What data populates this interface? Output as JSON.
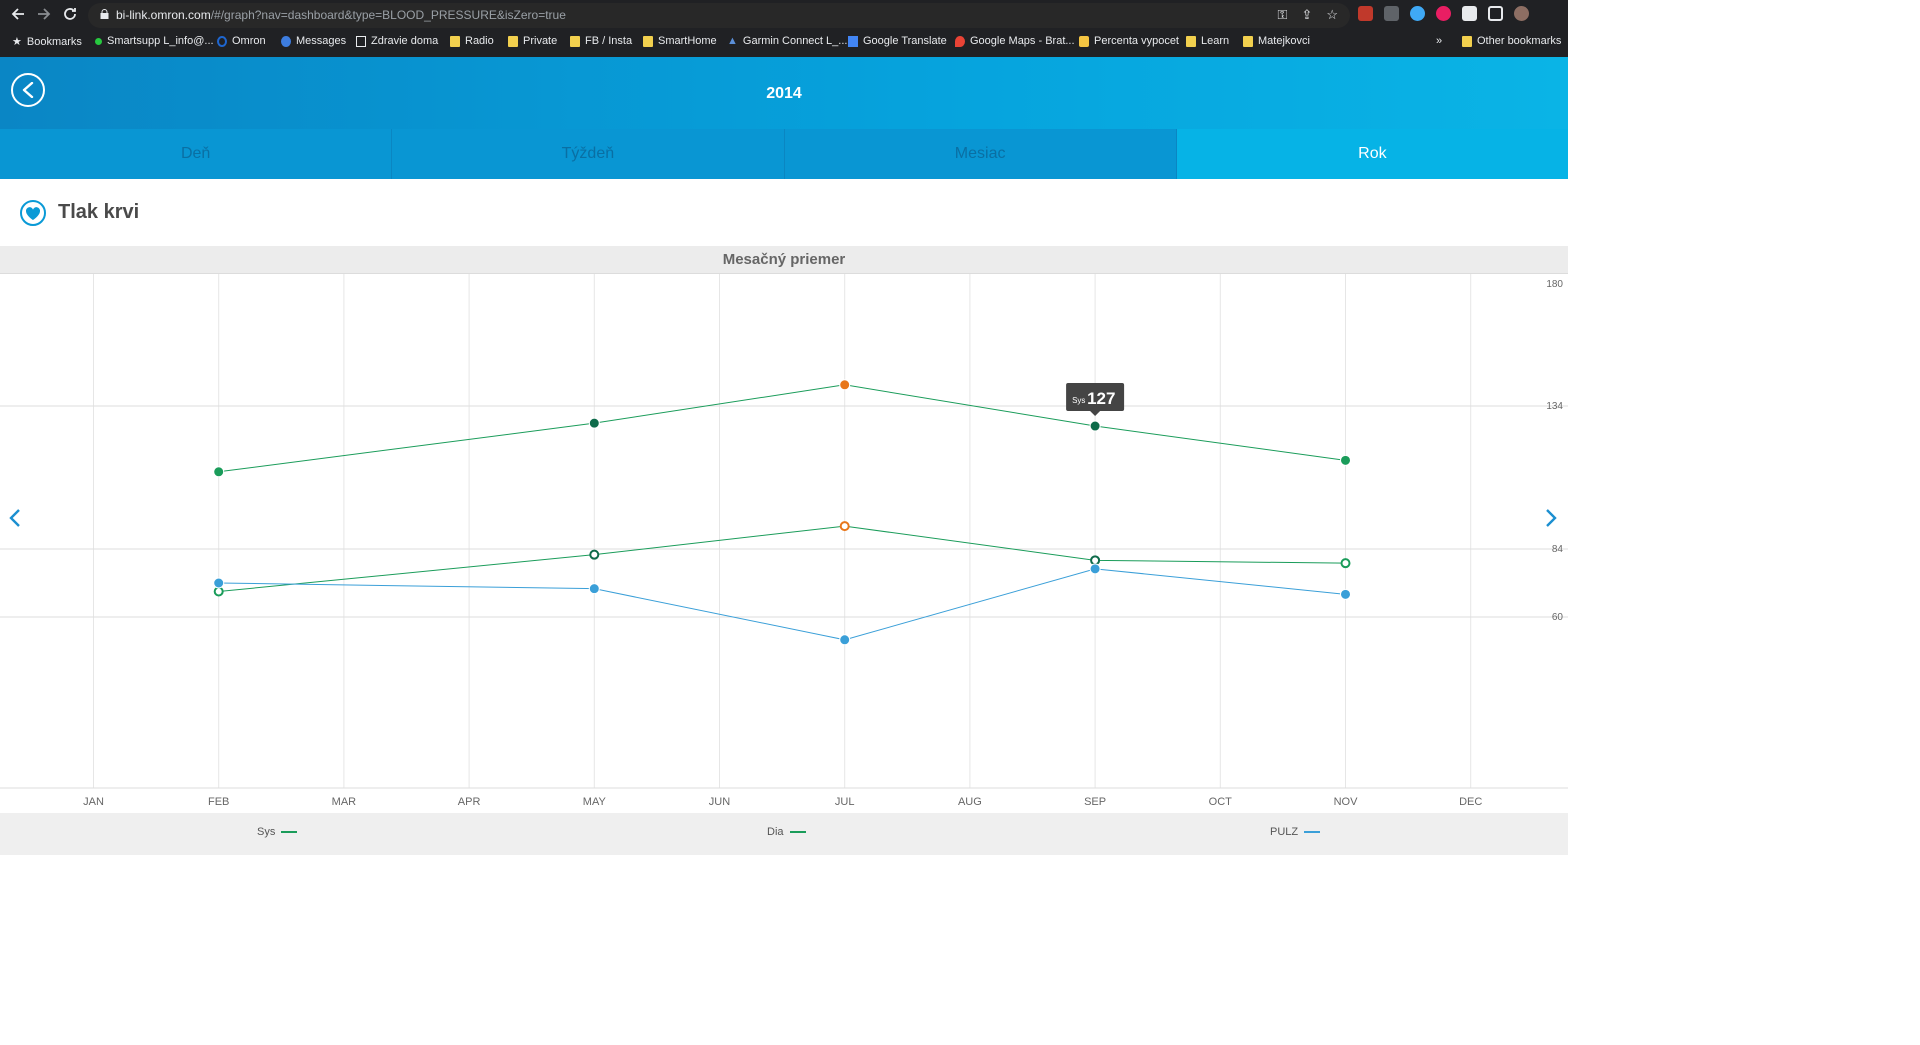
{
  "browser": {
    "url_domain": "bi-link.omron.com",
    "url_path": "/#/graph?nav=dashboard&type=BLOOD_PRESSURE&isZero=true",
    "bookmarks": [
      {
        "label": "Bookmarks",
        "icon": "star-icon"
      },
      {
        "label": "Smartsupp L_info@...",
        "icon": "dot-icon"
      },
      {
        "label": "Omron",
        "icon": "ring-icon"
      },
      {
        "label": "Messages",
        "icon": "chat-icon"
      },
      {
        "label": "Zdravie doma",
        "icon": "site-icon"
      },
      {
        "label": "Radio",
        "icon": "folder-icon"
      },
      {
        "label": "Private",
        "icon": "folder-icon"
      },
      {
        "label": "FB / Insta",
        "icon": "folder-icon"
      },
      {
        "label": "SmartHome",
        "icon": "folder-icon"
      },
      {
        "label": "Garmin Connect L_...",
        "icon": "garmin-icon"
      },
      {
        "label": "Google Translate",
        "icon": "translate-icon"
      },
      {
        "label": "Google Maps - Brat...",
        "icon": "maps-icon"
      },
      {
        "label": "Percenta vypocet",
        "icon": "site-icon"
      },
      {
        "label": "Learn",
        "icon": "folder-icon"
      },
      {
        "label": "Matejkovci",
        "icon": "folder-icon"
      }
    ],
    "overflow_label": "»",
    "other_bookmarks": "Other bookmarks"
  },
  "header": {
    "year": "2014",
    "tabs": [
      {
        "label": "Deň",
        "active": false
      },
      {
        "label": "Týždeň",
        "active": false
      },
      {
        "label": "Mesiac",
        "active": false
      },
      {
        "label": "Rok",
        "active": true
      }
    ]
  },
  "page": {
    "title": "Tlak krvi",
    "subtitle": "Mesačný priemer"
  },
  "chart_data": {
    "type": "line",
    "categories": [
      "JAN",
      "FEB",
      "MAR",
      "APR",
      "MAY",
      "JUN",
      "JUL",
      "AUG",
      "SEP",
      "OCT",
      "NOV",
      "DEC"
    ],
    "y_ticks": [
      180,
      134,
      84,
      60
    ],
    "ylim": [
      0,
      180
    ],
    "series": [
      {
        "name": "Sys",
        "color": "#1a9c5a",
        "points": [
          {
            "x": "FEB",
            "y": 111
          },
          {
            "x": "MAY",
            "y": 128
          },
          {
            "x": "JUL",
            "y": 142
          },
          {
            "x": "SEP",
            "y": 127
          },
          {
            "x": "NOV",
            "y": 115
          }
        ],
        "marker": "filled"
      },
      {
        "name": "Dia",
        "color": "#1a9c5a",
        "points": [
          {
            "x": "FEB",
            "y": 69
          },
          {
            "x": "MAY",
            "y": 82
          },
          {
            "x": "JUL",
            "y": 92
          },
          {
            "x": "SEP",
            "y": 80
          },
          {
            "x": "NOV",
            "y": 79
          }
        ],
        "marker": "hollow"
      },
      {
        "name": "PULZ",
        "color": "#3a9fd8",
        "points": [
          {
            "x": "FEB",
            "y": 72
          },
          {
            "x": "MAY",
            "y": 70
          },
          {
            "x": "JUL",
            "y": 52
          },
          {
            "x": "SEP",
            "y": 77
          },
          {
            "x": "NOV",
            "y": 68
          }
        ],
        "marker": "filled"
      }
    ],
    "highlight_color": "#e8761a",
    "highlight_x": "JUL",
    "selected_color": "#0e6b4a",
    "tooltip": {
      "label": "Sys",
      "value": "127",
      "x": "SEP"
    },
    "grid": true,
    "legend_position": "bottom"
  }
}
